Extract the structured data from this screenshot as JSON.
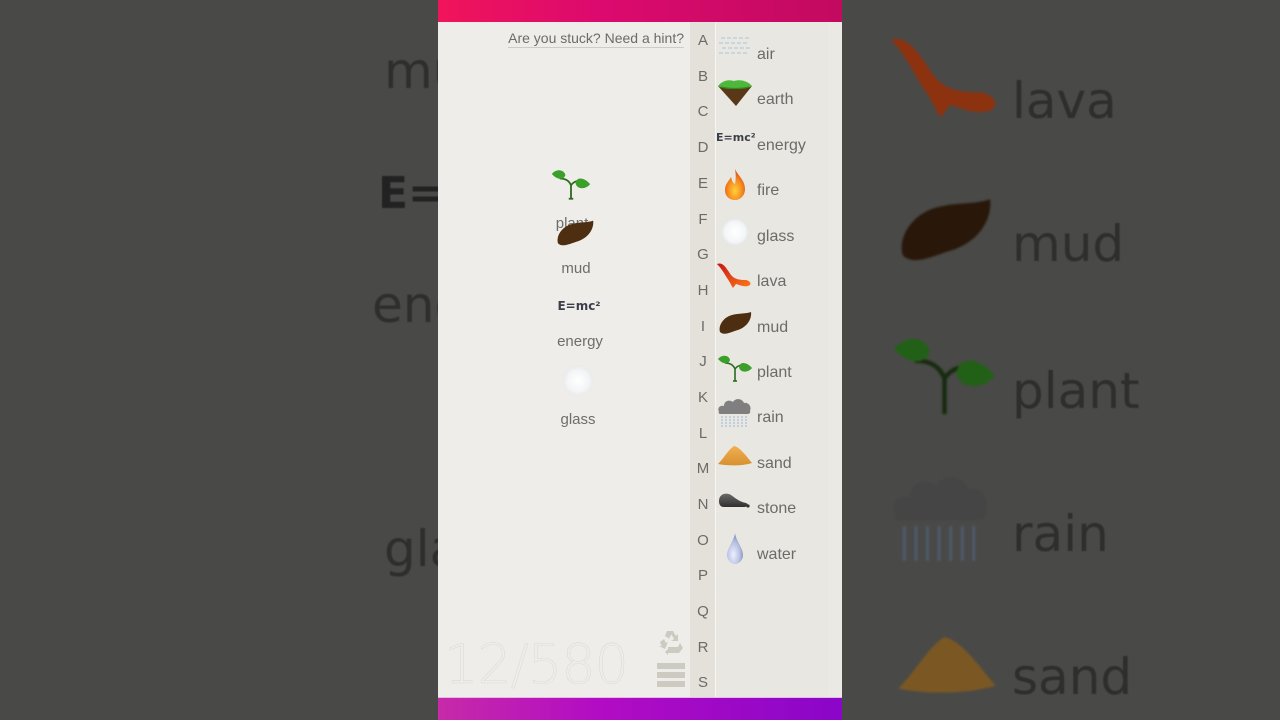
{
  "game": {
    "hint_link": "Are you stuck? Need a hint?",
    "progress": {
      "found": 12,
      "total": 580,
      "text": "12/580"
    },
    "colors": {
      "top_bar": "#dc0a6e",
      "bottom_bar": "#b20cc4",
      "background": "#eeece7",
      "text": "#6b6b68"
    }
  },
  "workspace": {
    "elements": [
      {
        "name": "plant",
        "icon": "plant-icon",
        "label": "plant"
      },
      {
        "name": "mud",
        "icon": "mud-icon",
        "label": "mud"
      },
      {
        "name": "energy",
        "icon": "energy-icon",
        "label": "energy",
        "icon_text": "E=mc²"
      },
      {
        "name": "glass",
        "icon": "glass-icon",
        "label": "glass"
      }
    ]
  },
  "alphabet": [
    "A",
    "B",
    "C",
    "D",
    "E",
    "F",
    "G",
    "H",
    "I",
    "J",
    "K",
    "L",
    "M",
    "N",
    "O",
    "P",
    "Q",
    "R",
    "S"
  ],
  "elements_list": [
    {
      "label": "air",
      "icon": "air-icon"
    },
    {
      "label": "earth",
      "icon": "earth-icon"
    },
    {
      "label": "energy",
      "icon": "energy-icon",
      "icon_text": "E=mc²"
    },
    {
      "label": "fire",
      "icon": "fire-icon"
    },
    {
      "label": "glass",
      "icon": "glass-icon"
    },
    {
      "label": "lava",
      "icon": "lava-icon"
    },
    {
      "label": "mud",
      "icon": "mud-icon"
    },
    {
      "label": "plant",
      "icon": "plant-icon"
    },
    {
      "label": "rain",
      "icon": "rain-icon"
    },
    {
      "label": "sand",
      "icon": "sand-icon"
    },
    {
      "label": "stone",
      "icon": "stone-icon"
    },
    {
      "label": "water",
      "icon": "water-icon"
    }
  ],
  "toolbar": {
    "recycle_icon": "recycle-icon",
    "menu_icon": "hamburger-menu-icon"
  },
  "background_blur": {
    "left_texts": [
      "mud",
      "E=",
      "ene",
      "gla"
    ],
    "right_texts": [
      "lava",
      "mud",
      "plant",
      "rain",
      "sand"
    ]
  }
}
